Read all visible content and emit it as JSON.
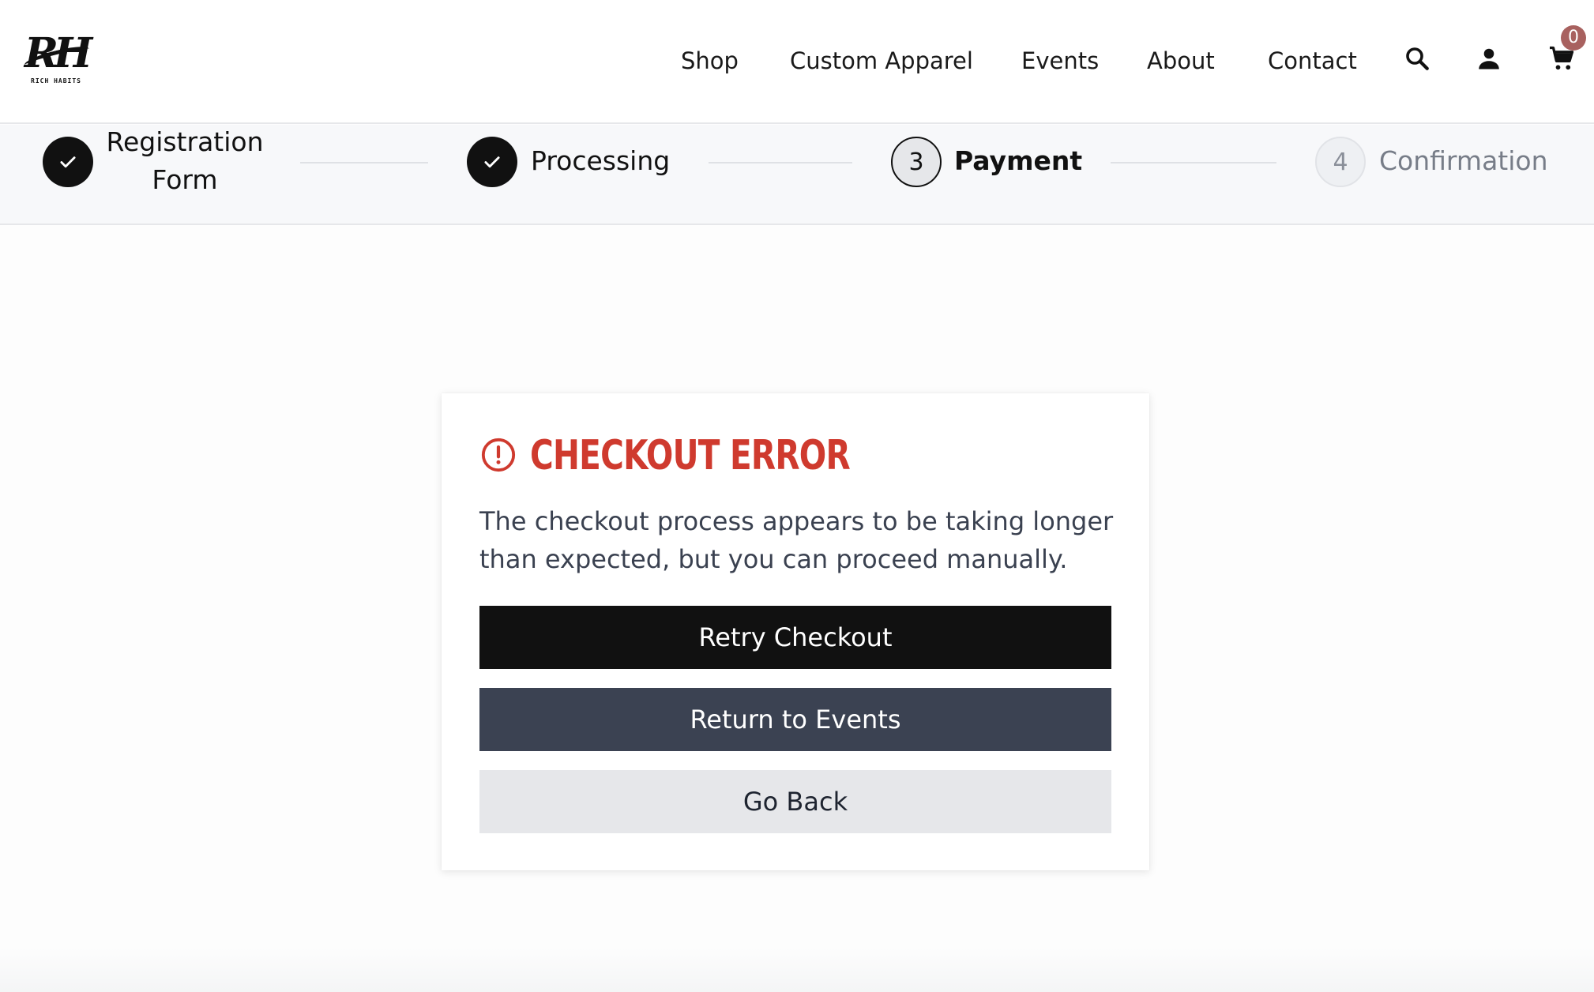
{
  "header": {
    "logo": {
      "mark": "RH",
      "subtext": "RICH HABITS"
    },
    "nav": [
      {
        "label": "Shop"
      },
      {
        "label": "Custom Apparel"
      },
      {
        "label": "Events"
      },
      {
        "label": "About"
      },
      {
        "label": "Contact"
      }
    ],
    "icons": [
      "search-icon",
      "account-icon",
      "cart-icon"
    ],
    "cart_count": "0",
    "cart_badge_color": "#a8615f"
  },
  "stepper": {
    "steps": [
      {
        "label_line1": "Registration",
        "label_line2": "Form",
        "state": "done"
      },
      {
        "label": "Processing",
        "state": "done"
      },
      {
        "number": "3",
        "label": "Payment",
        "state": "current"
      },
      {
        "number": "4",
        "label": "Confirmation",
        "state": "pending"
      }
    ]
  },
  "error_card": {
    "icon": "alert-circle-icon",
    "title": "CHECKOUT ERROR",
    "title_color": "#cf3a2e",
    "message": "The checkout process appears to be taking longer than expected, but you can proceed manually.",
    "buttons": {
      "retry": "Retry Checkout",
      "events": "Return to Events",
      "back": "Go Back"
    }
  }
}
